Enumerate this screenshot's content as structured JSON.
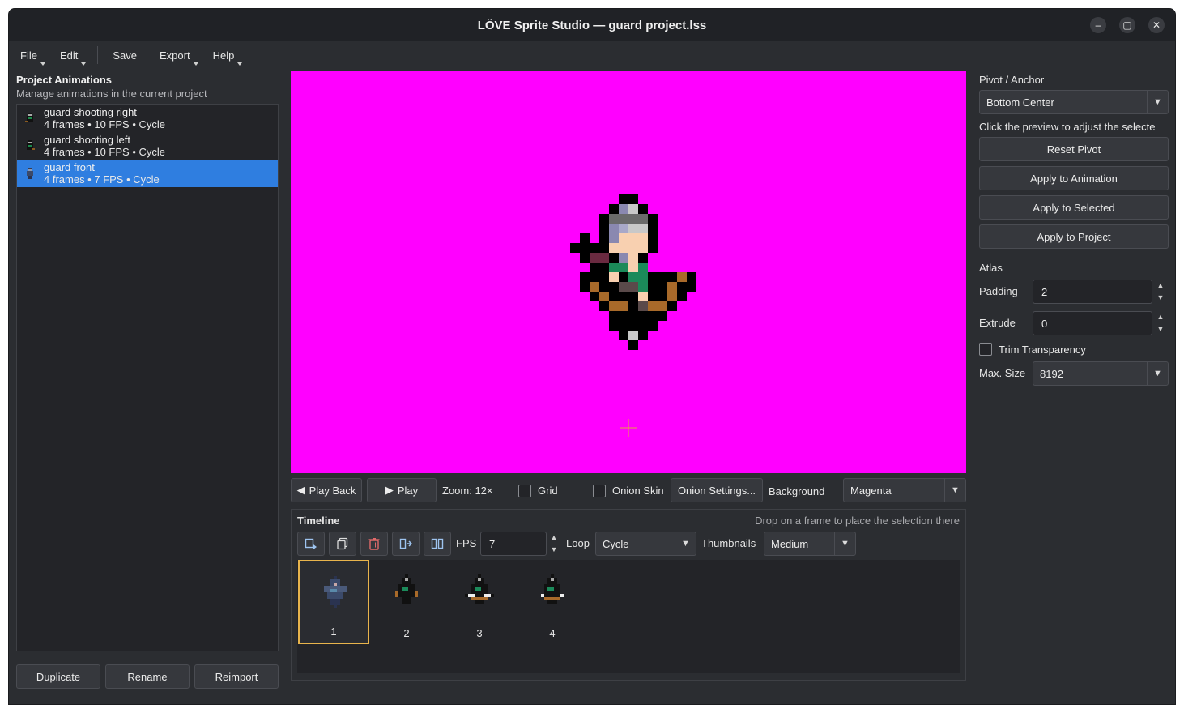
{
  "window": {
    "title": "LÖVE Sprite Studio — guard project.lss",
    "minimize": "–",
    "maximize": "▢",
    "close": "✕"
  },
  "menu": {
    "file": "File",
    "edit": "Edit",
    "save": "Save",
    "export": "Export",
    "help": "Help"
  },
  "left_panel": {
    "title": "Project Animations",
    "subtitle": "Manage animations in the current project",
    "animations": [
      {
        "name": "guard shooting right",
        "meta": "4 frames  •  10 FPS  •  Cycle",
        "selected": false
      },
      {
        "name": "guard shooting left",
        "meta": "4 frames  •  10 FPS  •  Cycle",
        "selected": false
      },
      {
        "name": "guard front",
        "meta": "4 frames  •  7 FPS  •  Cycle",
        "selected": true
      }
    ],
    "buttons": {
      "duplicate": "Duplicate",
      "rename": "Rename",
      "reimport": "Reimport"
    }
  },
  "preview": {
    "background_color": "#ff00ff",
    "pivot_color": "#e8a040"
  },
  "controls": {
    "play_back": "Play Back",
    "play": "Play",
    "zoom": "Zoom: 12×",
    "grid": "Grid",
    "grid_checked": false,
    "onion_skin": "Onion Skin",
    "onion_checked": false,
    "onion_settings": "Onion Settings...",
    "background_label": "Background",
    "background_value": "Magenta"
  },
  "timeline": {
    "title": "Timeline",
    "hint": "Drop on a frame to place the selection there",
    "fps_label": "FPS",
    "fps_value": "7",
    "loop_label": "Loop",
    "loop_value": "Cycle",
    "thumbnails_label": "Thumbnails",
    "thumbnails_value": "Medium",
    "frames": [
      {
        "number": "1",
        "selected": true
      },
      {
        "number": "2",
        "selected": false
      },
      {
        "number": "3",
        "selected": false
      },
      {
        "number": "4",
        "selected": false
      }
    ]
  },
  "right_panel": {
    "pivot_title": "Pivot / Anchor",
    "pivot_value": "Bottom Center",
    "pivot_hint": "Click the preview to adjust the selecte",
    "reset_pivot": "Reset Pivot",
    "apply_animation": "Apply to Animation",
    "apply_selected": "Apply to Selected",
    "apply_project": "Apply to Project",
    "atlas_title": "Atlas",
    "padding_label": "Padding",
    "padding_value": "2",
    "extrude_label": "Extrude",
    "extrude_value": "0",
    "trim_label": "Trim Transparency",
    "trim_checked": false,
    "max_size_label": "Max. Size",
    "max_size_value": "8192"
  },
  "colors": {
    "accent": "#2f7ee0",
    "frame_highlight": "#e8b44c",
    "delete_icon": "#e06a6a"
  }
}
